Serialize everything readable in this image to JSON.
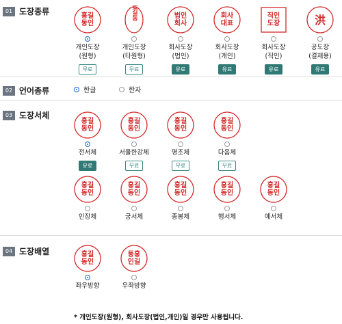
{
  "sections": {
    "seal_type": {
      "num": "01",
      "title": "도장종류"
    },
    "language": {
      "num": "02",
      "title": "언어종류"
    },
    "font": {
      "num": "03",
      "title": "도장서체"
    },
    "layout": {
      "num": "04",
      "title": "도장배열"
    }
  },
  "seal_types": [
    {
      "label1": "개인도장",
      "label2": "(원형)",
      "badge": "무료",
      "selected": true,
      "seal": "홍길\n동인",
      "shape": "circle"
    },
    {
      "label1": "개인도장",
      "label2": "(타원형)",
      "badge": "무료",
      "selected": false,
      "seal": "홍길동",
      "shape": "oval"
    },
    {
      "label1": "회사도장",
      "label2": "(법인)",
      "badge": "유료",
      "selected": false,
      "seal": "법인\n회사",
      "shape": "circle"
    },
    {
      "label1": "회사도장",
      "label2": "(개인)",
      "badge": "유료",
      "selected": false,
      "seal": "회사\n대표",
      "shape": "circle"
    },
    {
      "label1": "회사도장",
      "label2": "(직인)",
      "badge": "유료",
      "selected": false,
      "seal": "직인\n도장",
      "shape": "square"
    },
    {
      "label1": "공도장",
      "label2": "(결재용)",
      "badge": "유료",
      "selected": false,
      "seal": "洪",
      "shape": "circle"
    }
  ],
  "languages": [
    {
      "label": "한글",
      "selected": true
    },
    {
      "label": "한자",
      "selected": false
    }
  ],
  "fonts": [
    {
      "label": "전서체",
      "badge": "유료",
      "selected": true,
      "seal": "홍길\n동인"
    },
    {
      "label": "서울한강체",
      "badge": "무료",
      "selected": false,
      "seal": "홍길\n동인"
    },
    {
      "label": "명조체",
      "badge": "무료",
      "selected": false,
      "seal": "홍길\n동인"
    },
    {
      "label": "다음체",
      "badge": "무료",
      "selected": false,
      "seal": "홍길\n동인"
    },
    {
      "label": "인장체",
      "badge": "",
      "selected": false,
      "seal": "홍길\n동인"
    },
    {
      "label": "궁서체",
      "badge": "",
      "selected": false,
      "seal": "홍길\n동인"
    },
    {
      "label": "종봉체",
      "badge": "",
      "selected": false,
      "seal": "홍길\n동인"
    },
    {
      "label": "행서체",
      "badge": "",
      "selected": false,
      "seal": "홍길\n동인"
    },
    {
      "label": "예서체",
      "badge": "",
      "selected": false,
      "seal": "홍길\n동인"
    }
  ],
  "layouts": [
    {
      "label": "좌우방향",
      "selected": true,
      "seal": "홍길\n동인"
    },
    {
      "label": "우좌방향",
      "selected": false,
      "seal": "동홍\n인길"
    }
  ],
  "note": "* 개인도장(원형), 회사도장(법인,개인)일 경우만 사용됩니다.",
  "colors": {
    "seal_red": "#d32626",
    "badge_green": "#2f7a74",
    "radio_blue": "#2b6cd0"
  }
}
